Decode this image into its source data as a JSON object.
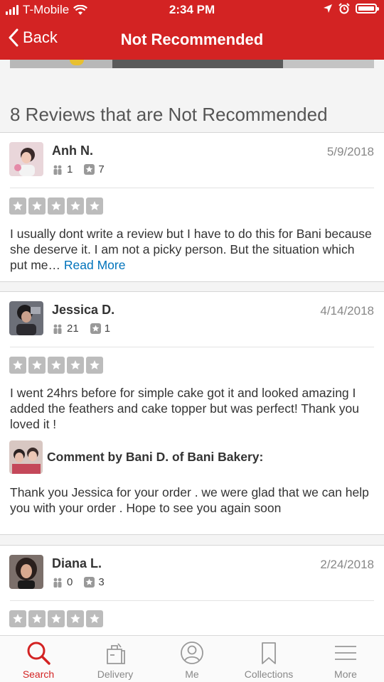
{
  "status": {
    "carrier": "T-Mobile",
    "time": "2:34 PM"
  },
  "nav": {
    "back_label": "Back",
    "title": "Not Recommended"
  },
  "heading": "8 Reviews that are Not Recommended",
  "reviews": [
    {
      "name": "Anh N.",
      "date": "5/9/2018",
      "friends": "1",
      "reviews": "7",
      "rating": 0,
      "text": "I usually dont write a review but I have to do this for Bani because she deserve it. I am not a picky person. But the situation which put me… ",
      "read_more": "Read More"
    },
    {
      "name": "Jessica D.",
      "date": "4/14/2018",
      "friends": "21",
      "reviews": "1",
      "rating": 0,
      "text": "I went 24hrs before for simple cake got it and looked amazing I added the feathers and cake topper but was perfect! Thank you loved it !",
      "comment_title": "Comment by Bani D. of Bani Bakery:",
      "comment_text": "Thank you Jessica for your order . we were glad that we can help you with your order . Hope to see you again soon"
    },
    {
      "name": "Diana L.",
      "date": "2/24/2018",
      "friends": "0",
      "reviews": "3",
      "rating": 0
    }
  ],
  "tabs": [
    {
      "label": "Search",
      "icon": "search-icon",
      "active": true
    },
    {
      "label": "Delivery",
      "icon": "delivery-icon",
      "active": false
    },
    {
      "label": "Me",
      "icon": "profile-icon",
      "active": false
    },
    {
      "label": "Collections",
      "icon": "bookmark-icon",
      "active": false
    },
    {
      "label": "More",
      "icon": "menu-icon",
      "active": false
    }
  ],
  "colors": {
    "brand": "#d32323",
    "link": "#0073bb",
    "star_empty": "#bcbcbc"
  }
}
